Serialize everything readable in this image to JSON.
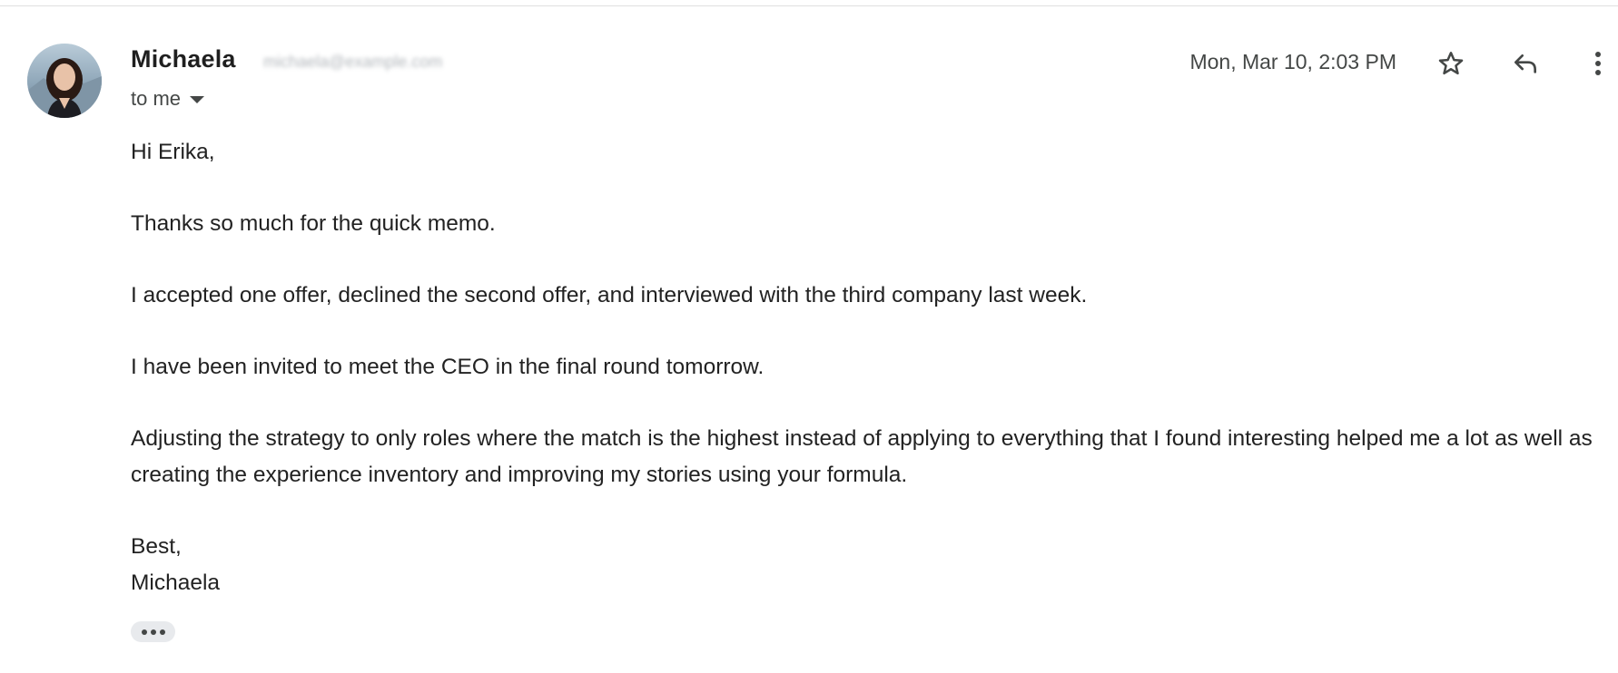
{
  "sender": {
    "name": "Michaela",
    "email": "michaela@example.com",
    "recipient_label": "to me"
  },
  "timestamp": "Mon, Mar 10, 2:03 PM",
  "actions": {
    "star": "star-icon",
    "reply": "reply-icon",
    "more": "more-vert-icon"
  },
  "body": {
    "greeting": "Hi Erika,",
    "paragraphs": [
      "Thanks so much for the quick memo.",
      "I accepted one offer, declined the second offer, and interviewed with the third company last week.",
      "I have been invited to meet the CEO in the final round tomorrow.",
      "Adjusting the strategy to only roles where the match is the highest instead of applying to everything that I found interesting helped me a lot as well as creating the experience inventory and improving my stories using your formula."
    ],
    "signoff": "Best,",
    "signature": "Michaela"
  },
  "colors": {
    "text": "#1f1f1f",
    "secondary": "#444746",
    "pill": "#e8eaed"
  }
}
